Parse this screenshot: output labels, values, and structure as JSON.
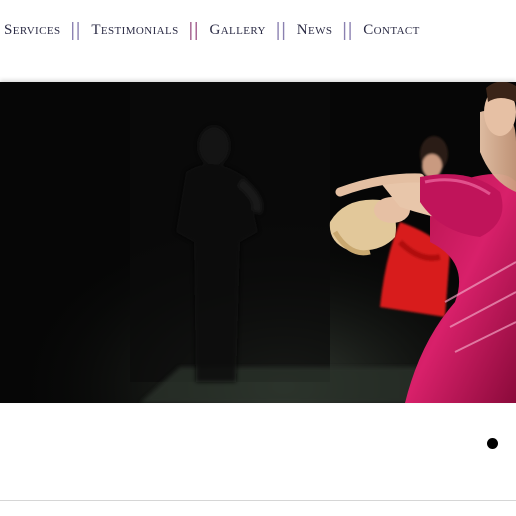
{
  "nav": {
    "items": [
      {
        "label": "Services"
      },
      {
        "label": "Testimonials"
      },
      {
        "label": "Gallery"
      },
      {
        "label": "News"
      },
      {
        "label": "Contact"
      }
    ],
    "separator": "||"
  },
  "hero": {
    "description_icon": "dance-photo"
  },
  "slider": {
    "dot_icon": "slide-indicator-dot"
  }
}
